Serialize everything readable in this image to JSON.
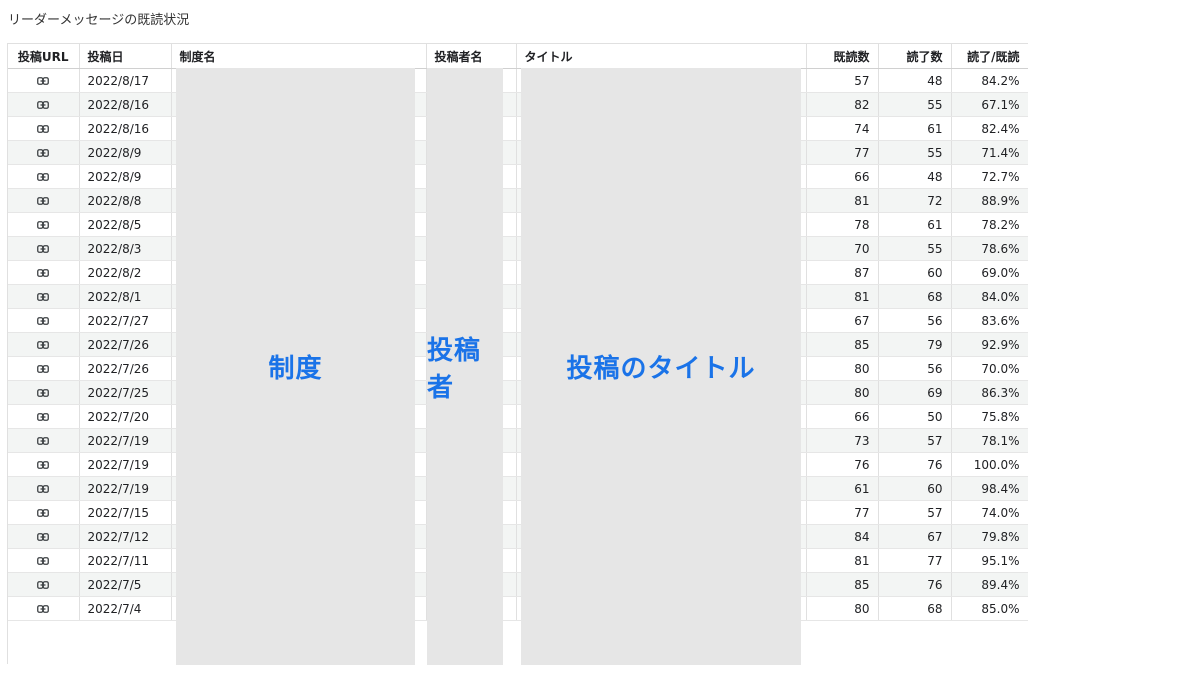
{
  "page": {
    "title": "リーダーメッセージの既読状況"
  },
  "table": {
    "headers": {
      "url": "投稿URL",
      "date": "投稿日",
      "system": "制度名",
      "poster": "投稿者名",
      "title": "タイトル",
      "read": "既読数",
      "complete": "読了数",
      "ratio": "読了/既読"
    },
    "rows": [
      {
        "date": "2022/8/17",
        "read": "57",
        "complete": "48",
        "ratio": "84.2%"
      },
      {
        "date": "2022/8/16",
        "read": "82",
        "complete": "55",
        "ratio": "67.1%"
      },
      {
        "date": "2022/8/16",
        "read": "74",
        "complete": "61",
        "ratio": "82.4%"
      },
      {
        "date": "2022/8/9",
        "read": "77",
        "complete": "55",
        "ratio": "71.4%"
      },
      {
        "date": "2022/8/9",
        "read": "66",
        "complete": "48",
        "ratio": "72.7%"
      },
      {
        "date": "2022/8/8",
        "read": "81",
        "complete": "72",
        "ratio": "88.9%"
      },
      {
        "date": "2022/8/5",
        "read": "78",
        "complete": "61",
        "ratio": "78.2%"
      },
      {
        "date": "2022/8/3",
        "read": "70",
        "complete": "55",
        "ratio": "78.6%"
      },
      {
        "date": "2022/8/2",
        "read": "87",
        "complete": "60",
        "ratio": "69.0%"
      },
      {
        "date": "2022/8/1",
        "read": "81",
        "complete": "68",
        "ratio": "84.0%"
      },
      {
        "date": "2022/7/27",
        "read": "67",
        "complete": "56",
        "ratio": "83.6%"
      },
      {
        "date": "2022/7/26",
        "read": "85",
        "complete": "79",
        "ratio": "92.9%"
      },
      {
        "date": "2022/7/26",
        "read": "80",
        "complete": "56",
        "ratio": "70.0%"
      },
      {
        "date": "2022/7/25",
        "read": "80",
        "complete": "69",
        "ratio": "86.3%"
      },
      {
        "date": "2022/7/20",
        "read": "66",
        "complete": "50",
        "ratio": "75.8%"
      },
      {
        "date": "2022/7/19",
        "read": "73",
        "complete": "57",
        "ratio": "78.1%"
      },
      {
        "date": "2022/7/19",
        "read": "76",
        "complete": "76",
        "ratio": "100.0%"
      },
      {
        "date": "2022/7/19",
        "read": "61",
        "complete": "60",
        "ratio": "98.4%"
      },
      {
        "date": "2022/7/15",
        "read": "77",
        "complete": "57",
        "ratio": "74.0%"
      },
      {
        "date": "2022/7/12",
        "read": "84",
        "complete": "67",
        "ratio": "79.8%"
      },
      {
        "date": "2022/7/11",
        "read": "81",
        "complete": "77",
        "ratio": "95.1%"
      },
      {
        "date": "2022/7/5",
        "read": "85",
        "complete": "76",
        "ratio": "89.4%"
      },
      {
        "date": "2022/7/4",
        "read": "80",
        "complete": "68",
        "ratio": "85.0%"
      }
    ]
  },
  "redactions": {
    "system": "制度",
    "poster": "投稿者",
    "title": "投稿のタイトル"
  },
  "icons": {
    "link": "link-icon"
  },
  "colors": {
    "redaction_label": "#1a73e8",
    "redaction_fill": "#e6e6e6",
    "row_stripe": "#f3f5f4"
  }
}
